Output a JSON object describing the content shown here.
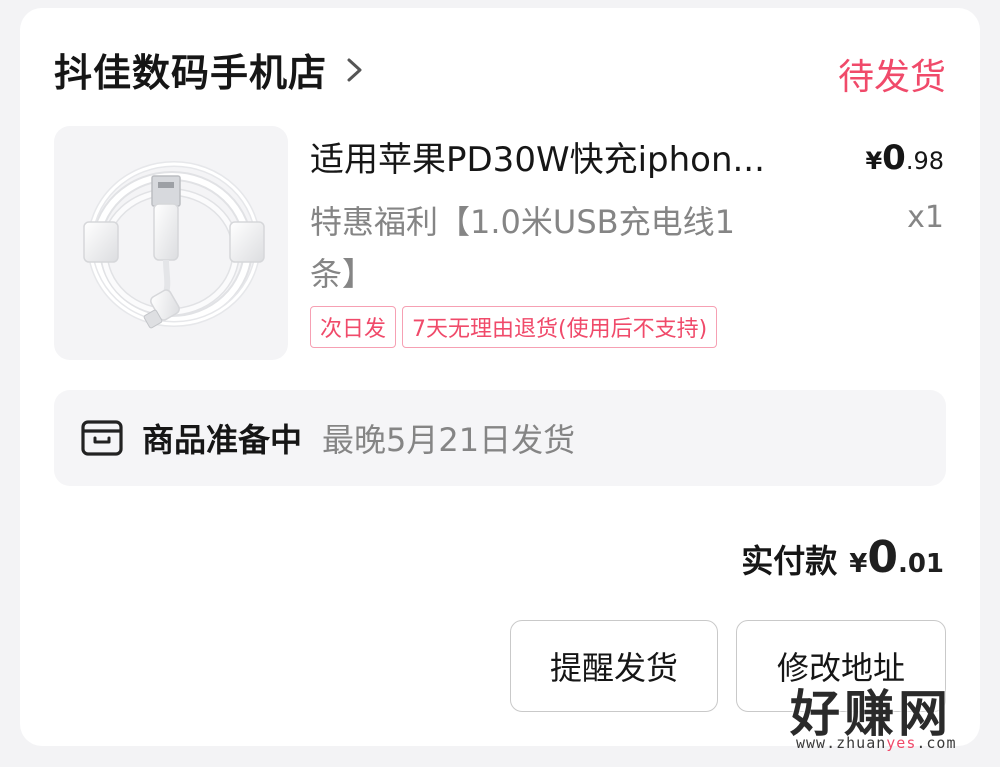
{
  "shop": {
    "name": "抖佳数码手机店",
    "status": "待发货"
  },
  "product": {
    "title": "适用苹果PD30W快充iphon...",
    "price_symbol": "¥",
    "price_integer": "0",
    "price_decimal": ".98",
    "spec": "特惠福利【1.0米USB充电线1条】",
    "quantity": "x1",
    "tags": [
      "次日发",
      "7天无理由退货(使用后不支持)"
    ]
  },
  "preparation": {
    "title": "商品准备中",
    "detail": "最晚5月21日发货"
  },
  "payment": {
    "label": "实付款",
    "symbol": "¥",
    "integer": "0",
    "decimal": ".01"
  },
  "actions": {
    "remind_label": "提醒发货",
    "modify_address_label": "修改地址"
  },
  "watermark": {
    "main": "好赚网",
    "sub_prefix": "www.zhuan",
    "sub_accent": "yes",
    "sub_suffix": ".com"
  },
  "colors": {
    "accent": "#f04a6a",
    "tag_border": "#f6a0b3",
    "secondary_text": "#858585",
    "panel_bg": "#f5f5f7"
  },
  "icons": [
    "chevron-right-icon",
    "package-box-icon",
    "usb-cable-image"
  ]
}
